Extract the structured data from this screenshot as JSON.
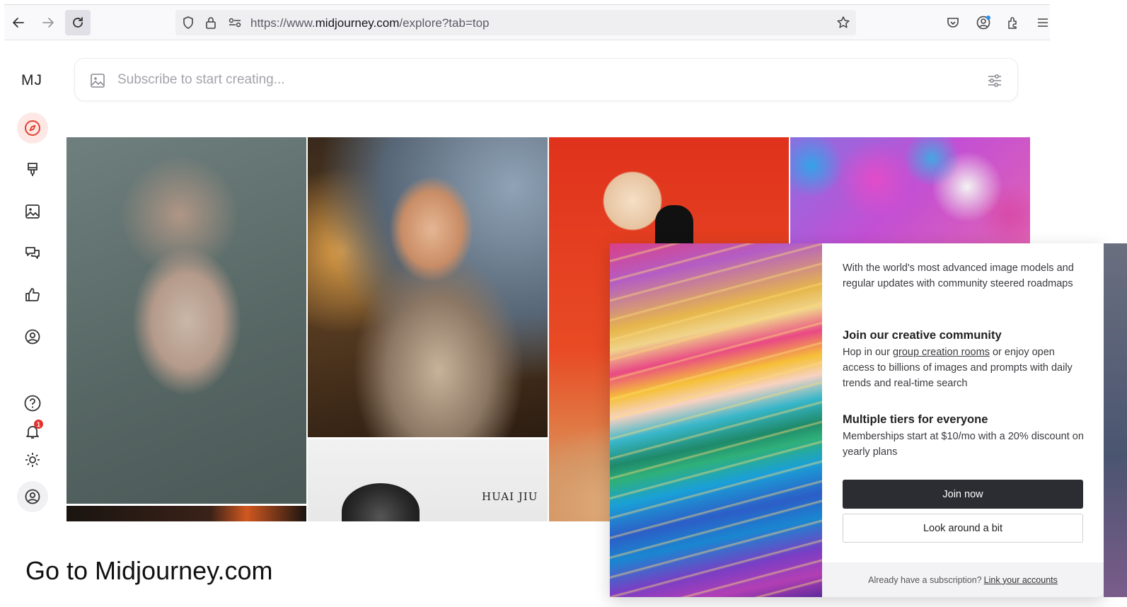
{
  "browser": {
    "url_prefix": "https://www.",
    "url_domain": "midjourney.com",
    "url_path": "/explore?tab=top"
  },
  "app": {
    "logo": "MJ",
    "prompt_placeholder": "Subscribe to start creating...",
    "notification_count": "1"
  },
  "gallery": {
    "watermark_text": "HUAI JIU"
  },
  "modal": {
    "intro": "With the world's most advanced image models and regular updates with community steered roadmaps",
    "community_heading": "Join our creative community",
    "community_pre": "Hop in our ",
    "community_link": "group creation rooms",
    "community_post": " or enjoy open access to billions of images and prompts with daily trends and real-time search",
    "tiers_heading": "Multiple tiers for everyone",
    "tiers_text": "Memberships start at $10/mo with a 20% discount on yearly plans",
    "join_label": "Join now",
    "look_label": "Look around a bit",
    "footer_text": "Already have a subscription?",
    "footer_link": "Link your accounts"
  },
  "caption": "Go to Midjourney.com",
  "icons": [
    "back-icon",
    "forward-icon",
    "reload-icon",
    "shield-icon",
    "lock-icon",
    "permissions-icon",
    "bookmark-star-icon",
    "pocket-icon",
    "account-icon",
    "extensions-icon",
    "menu-icon",
    "image-icon",
    "settings-sliders-icon",
    "compass-icon",
    "brush-icon",
    "gallery-icon",
    "chat-icon",
    "thumbs-up-icon",
    "profile-icon",
    "help-icon",
    "bell-icon",
    "sun-icon",
    "user-icon"
  ]
}
